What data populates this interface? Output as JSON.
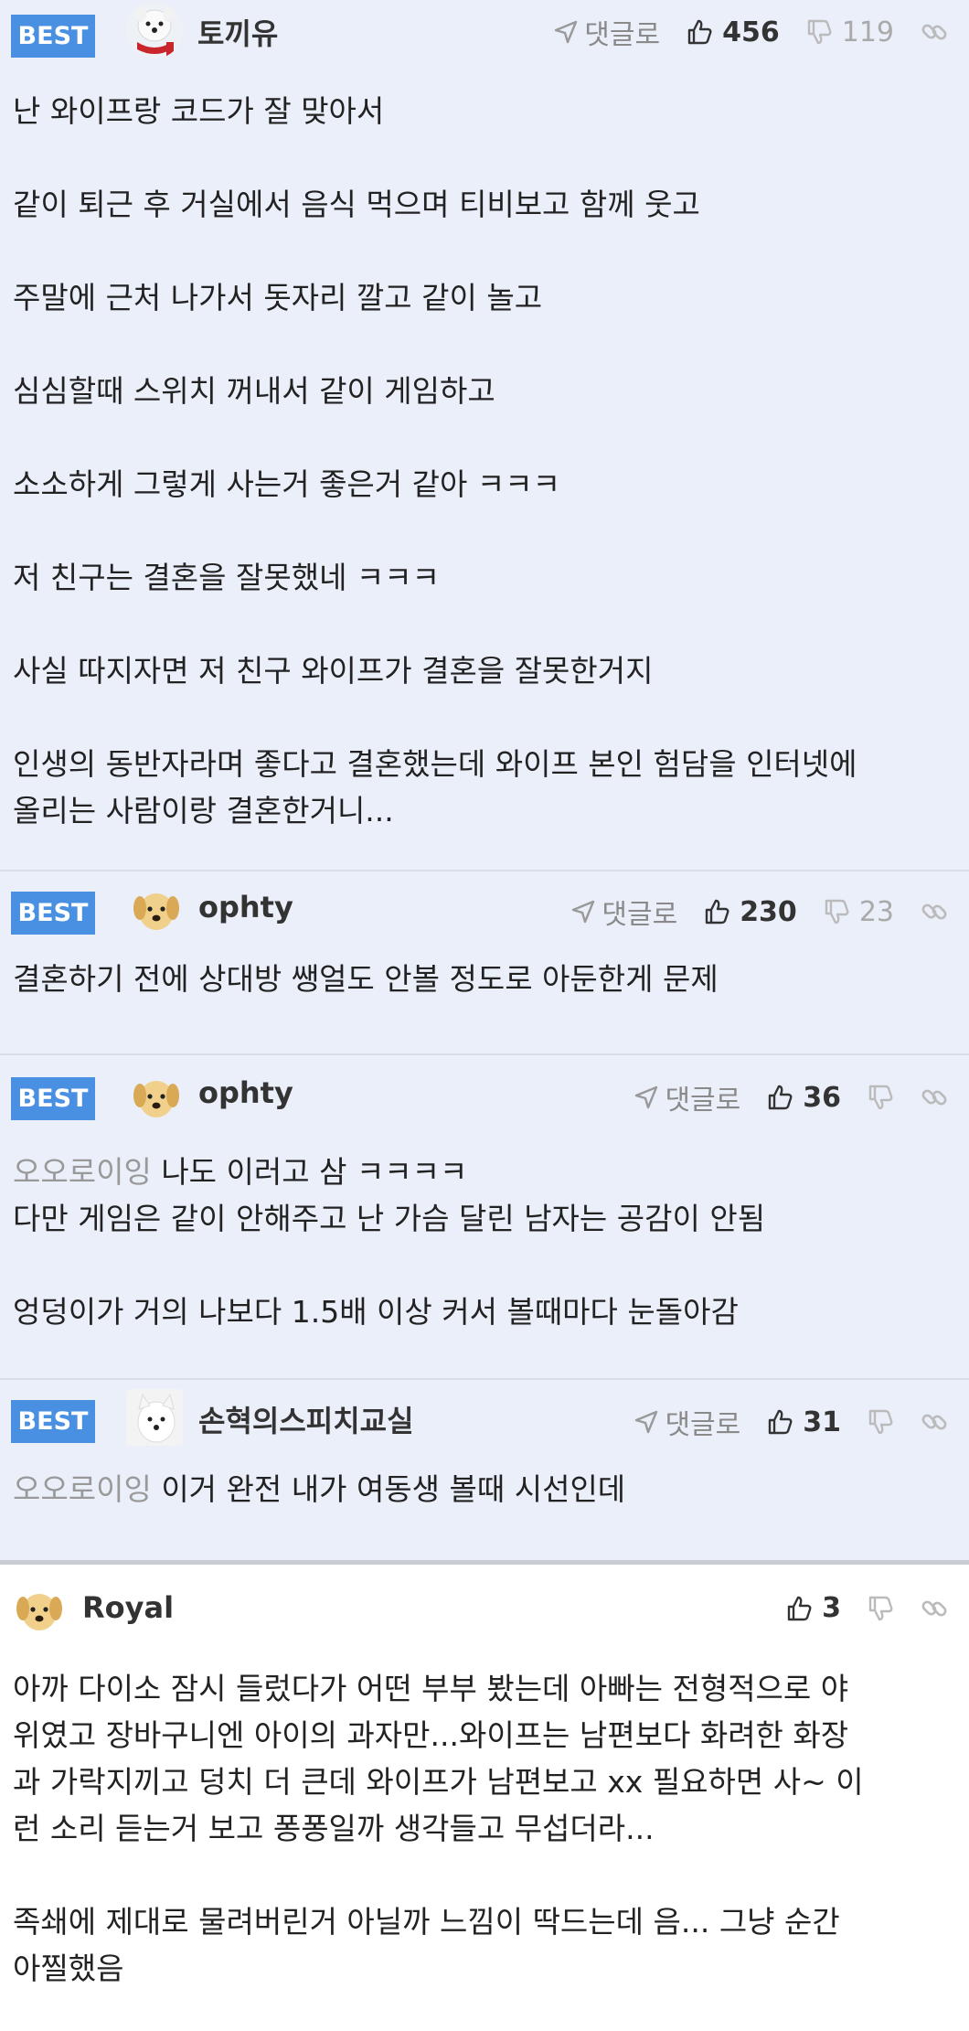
{
  "labels": {
    "best": "BEST",
    "reply": "댓글로"
  },
  "comments": [
    {
      "best": true,
      "nickname": "토끼유",
      "avatar": "white-dog-with-red-scarf",
      "up": "456",
      "down": "119",
      "paragraphs": [
        "난 와이프랑 코드가 잘 맞아서",
        "같이 퇴근 후 거실에서 음식 먹으며 티비보고 함께 웃고",
        "주말에 근처 나가서 돗자리 깔고 같이 놀고",
        "심심할때 스위치 꺼내서 같이 게임하고",
        "소소하게 그렇게 사는거 좋은거 같아 ㅋㅋㅋ",
        "저 친구는 결혼을 잘못했네 ㅋㅋㅋ",
        "사실 따지자면 저 친구 와이프가 결혼을 잘못한거지",
        "인생의 동반자라며 좋다고 결혼했는데 와이프 본인 험담을 인터넷에\n올리는 사람이랑 결혼한거니..."
      ]
    },
    {
      "best": true,
      "nickname": "ophty",
      "avatar": "puppy",
      "up": "230",
      "down": "23",
      "paragraphs": [
        "결혼하기 전에 상대방 쌩얼도 안볼 정도로 아둔한게 문제"
      ]
    },
    {
      "best": true,
      "nickname": "ophty",
      "avatar": "puppy",
      "up": "36",
      "down": "",
      "mention": "오오로이잉",
      "first_line": "나도 이러고 삼 ㅋㅋㅋㅋ",
      "paragraphs": [
        "다만 게임은 같이 안해주고 난 가슴 달린 남자는 공감이 안됨",
        "",
        "엉덩이가 거의 나보다 1.5배 이상 커서 볼때마다 눈돌아감"
      ]
    },
    {
      "best": true,
      "nickname": "손혁의스피치교실",
      "avatar": "white-dog",
      "up": "31",
      "down": "",
      "mention": "오오로이잉",
      "first_line": "이거 완전 내가 여동생 볼때 시선인데",
      "paragraphs": []
    },
    {
      "best": false,
      "nickname": "Royal",
      "avatar": "puppy",
      "up": "3",
      "down": "",
      "paragraphs": [
        "아까 다이소 잠시 들렀다가 어떤 부부 봤는데 아빠는 전형적으로 야\n위였고 장바구니엔 아이의 과자만...와이프는 남편보다 화려한 화장\n과 가락지끼고 덩치 더 큰데 와이프가 남편보고 xx 필요하면 사~ 이\n런 소리 듣는거 보고 퐁퐁일까 생각들고 무섭더라...",
        "족쇄에 제대로 물려버린거 아닐까 느낌이 딱드는데 음... 그냥 순간\n아찔했음"
      ]
    }
  ],
  "colors": {
    "best_bg": "#ebeffa",
    "badge": "#4a90e2",
    "mention": "#999999"
  }
}
